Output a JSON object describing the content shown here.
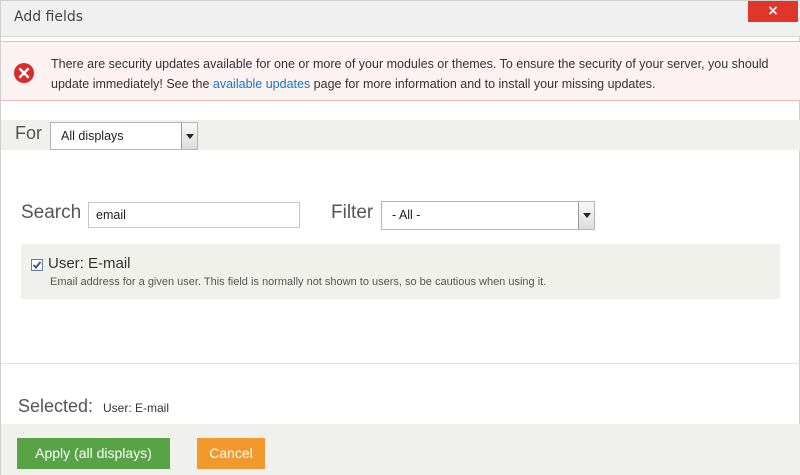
{
  "dialog": {
    "title": "Add fields",
    "close_symbol": "×"
  },
  "alert": {
    "text_before": "There are security updates available for one or more of your modules or themes. To ensure the security of your server, you should update immediately! See the ",
    "link": "available updates",
    "text_after": " page for more information and to install your missing updates.",
    "icon": "error-icon"
  },
  "for_bar": {
    "label": "For",
    "selected": "All displays"
  },
  "search": {
    "label": "Search",
    "value": "email"
  },
  "filter": {
    "label": "Filter",
    "selected": "- All -"
  },
  "results": [
    {
      "checked": true,
      "name": "User: E-mail",
      "description": "Email address for a given user. This field is normally not shown to users, so be cautious when using it."
    }
  ],
  "selected": {
    "label": "Selected:",
    "value": "User: E-mail"
  },
  "footer": {
    "apply_label": "Apply (all displays)",
    "cancel_label": "Cancel"
  },
  "colors": {
    "apply": "#57a345",
    "cancel": "#f2992e",
    "close": "#e0352b",
    "error": "#d82c2c",
    "link": "#1a76c2"
  }
}
